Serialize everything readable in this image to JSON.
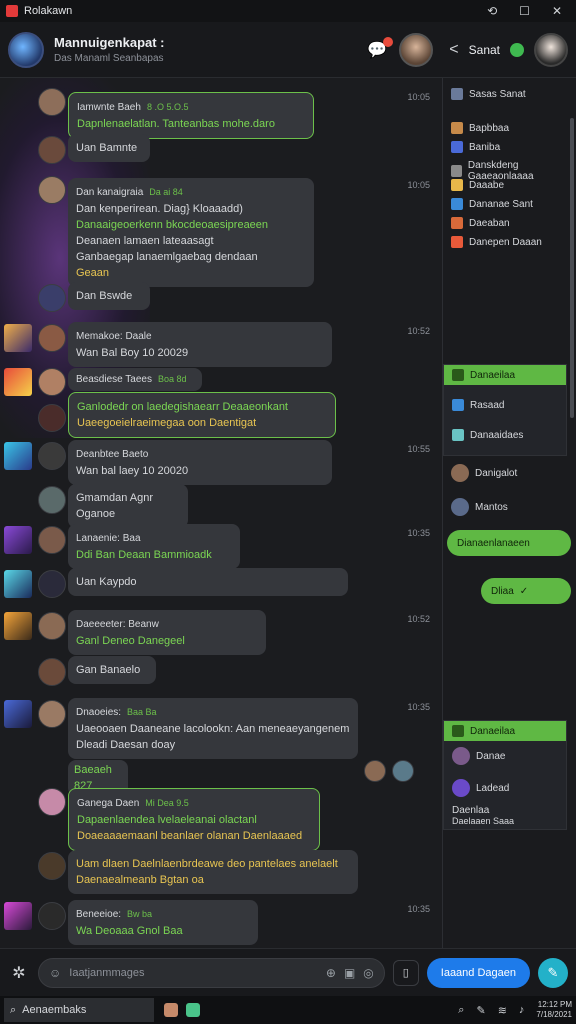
{
  "window": {
    "title": "Rolakawn",
    "controls": [
      "⟲",
      "☐",
      "✕"
    ]
  },
  "header": {
    "title": "Mannuigenkapat :",
    "subtitle": "Das Manaml Seanbapas",
    "right_name": "Sanat",
    "back": "<"
  },
  "messages": [
    {
      "name": "Iamwnte Baeh",
      "meta": "8 .O 5.O.5",
      "lines": [
        "Dapnlenaelatlan. Tanteanbas mohe.daro"
      ],
      "time": "10:05"
    },
    {
      "name": "",
      "meta": "",
      "lines": [
        "Uan Bamnte"
      ],
      "time": ""
    },
    {
      "name": "Dan kanaigraia",
      "meta": "Da ai 84",
      "lines": [
        "Dan kenperirean. Diag} Kloaaadd)",
        "Danaaigeoerkenn bkocdeoaesipreaeen",
        "Deanaen lamaen lateaasagt",
        "Ganbaegap lanaemlgaebag dendaan",
        "Geaan"
      ],
      "time": "10:05"
    },
    {
      "name": "",
      "meta": "",
      "lines": [
        "Dan Bswde"
      ],
      "time": ""
    },
    {
      "name": "Memakoe: Daale",
      "meta": "",
      "lines": [
        "Wan Bal Boy 10 20029"
      ],
      "time": "10:52"
    },
    {
      "name": "Beasdiese Taees",
      "meta": "Boa 8d",
      "lines": [],
      "time": ""
    },
    {
      "name": "",
      "meta": "",
      "lines": [
        "Ganlodedr on laedegishaearr Deaaeonkant",
        "Uaeegoeielraeimegaa oon Daentigat"
      ],
      "time": ""
    },
    {
      "name": "Deanbtee Baeto",
      "meta": "",
      "lines": [
        "Wan bal laey 10 20020"
      ],
      "time": "10:55"
    },
    {
      "name": "",
      "meta": "",
      "lines": [
        "Gmamdan Agnr Oganoe"
      ],
      "time": ""
    },
    {
      "name": "Lanaenie: Baa",
      "meta": "",
      "lines": [
        "Ddi Ban Deaan Bammioadk"
      ],
      "time": "10:35"
    },
    {
      "name": "",
      "meta": "",
      "lines": [
        "Uan Kaypdo"
      ],
      "time": ""
    },
    {
      "name": "Daeeeeter: Beanw",
      "meta": "",
      "lines": [
        "Ganl Deneo Danegeel"
      ],
      "time": "10:52"
    },
    {
      "name": "",
      "meta": "",
      "lines": [
        "Gan Banaelo"
      ],
      "time": ""
    },
    {
      "name": "Dnaoeies:",
      "meta": "Baa Ba",
      "lines": [
        "Uaeooaen Daaneane lacolookn: Aan meneaeyangenem",
        "Dleadi Daesan doay"
      ],
      "time": "10:35"
    },
    {
      "name": "",
      "meta": "",
      "lines": [
        "Baeaeh 827"
      ],
      "time": ""
    },
    {
      "name": "Ganega Daen",
      "meta": "Mi Dea 9.5",
      "lines": [
        "Dapaenlaendea lvelaeleanai olactanl",
        "Doaeaaaemaanl beanlaer olanan Daenlaaaed"
      ],
      "time": ""
    },
    {
      "name": "",
      "meta": "",
      "lines": [
        "Uam dlaen Daelnlaenbrdeawe deo pantelaes anelaelt",
        "Daenaealmeanb Bgtan oa"
      ],
      "time": ""
    },
    {
      "name": "Beneeioe:",
      "meta": "Bw ba",
      "lines": [
        "Wa Deoaaa Gnol Baa"
      ],
      "time": "10:35"
    }
  ],
  "right_panel": {
    "top_header": "Sasas Sanat",
    "items": [
      "Bapbbaa",
      "Baniba",
      "Danskdeng Gaaeaonlaaaa",
      "Daaabe",
      "Dananae Sant",
      "Daeaban",
      "Danepen Daaan"
    ],
    "card1": {
      "header": "Danaeilaa",
      "rows": [
        "Rasaad",
        "Danaaidaes"
      ]
    },
    "items2": [
      "Danigalot",
      "Mantos"
    ],
    "pill1": "Dianaenlanaeen",
    "pill2": "Dliaa",
    "card2": {
      "header": "Danaeilaa",
      "rows": [
        "Danae",
        "Ladead",
        "Daenlaa",
        "Daelaaen Saaa"
      ]
    }
  },
  "composer": {
    "placeholder": "Iaatjanmmages",
    "send_label": "Iaaand Dagaen"
  },
  "taskbar": {
    "search": "Aenaembaks",
    "clock_time": "12:12 PM",
    "clock_date": "7/18/2021"
  },
  "colors": {
    "accent_green": "#5fb844",
    "send_blue": "#1e7bea",
    "notif_red": "#e74b3c"
  }
}
